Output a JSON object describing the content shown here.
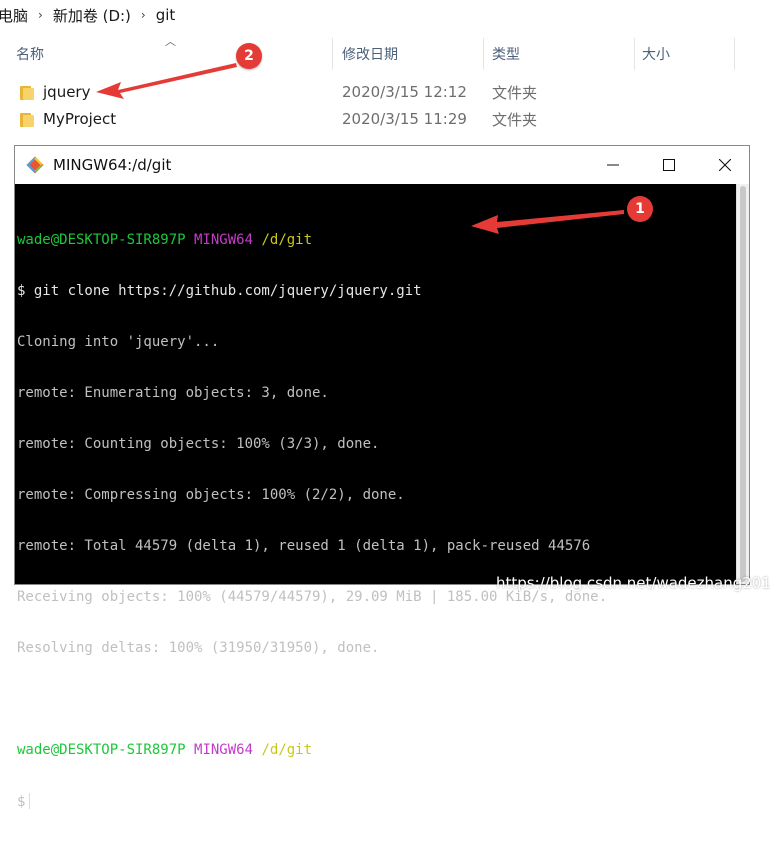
{
  "breadcrumb": {
    "items": [
      "电脑",
      "新加卷 (D:)",
      "git"
    ],
    "separator": "›"
  },
  "columns": {
    "name": "名称",
    "modified": "修改日期",
    "type": "类型",
    "size": "大小"
  },
  "files": [
    {
      "name": "jquery",
      "modified": "2020/3/15 12:12",
      "type": "文件夹"
    },
    {
      "name": "MyProject",
      "modified": "2020/3/15 11:29",
      "type": "文件夹"
    }
  ],
  "terminal": {
    "title": "MINGW64:/d/git",
    "prompt1": {
      "user": "wade@DESKTOP-SIR897P",
      "env": "MINGW64",
      "path": "/d/git"
    },
    "command": "$ git clone https://github.com/jquery/jquery.git",
    "output": [
      "Cloning into 'jquery'...",
      "remote: Enumerating objects: 3, done.",
      "remote: Counting objects: 100% (3/3), done.",
      "remote: Compressing objects: 100% (2/2), done.",
      "remote: Total 44579 (delta 1), reused 1 (delta 1), pack-reused 44576",
      "Receiving objects: 100% (44579/44579), 29.09 MiB | 185.00 KiB/s, done.",
      "Resolving deltas: 100% (31950/31950), done."
    ],
    "prompt2": {
      "user": "wade@DESKTOP-SIR897P",
      "env": "MINGW64",
      "path": "/d/git"
    },
    "input_prompt": "$"
  },
  "annotations": {
    "badge1": "1",
    "badge2": "2",
    "color": "#e53b36"
  },
  "watermark": "https://blog.csdn.net/wadezhang2017"
}
